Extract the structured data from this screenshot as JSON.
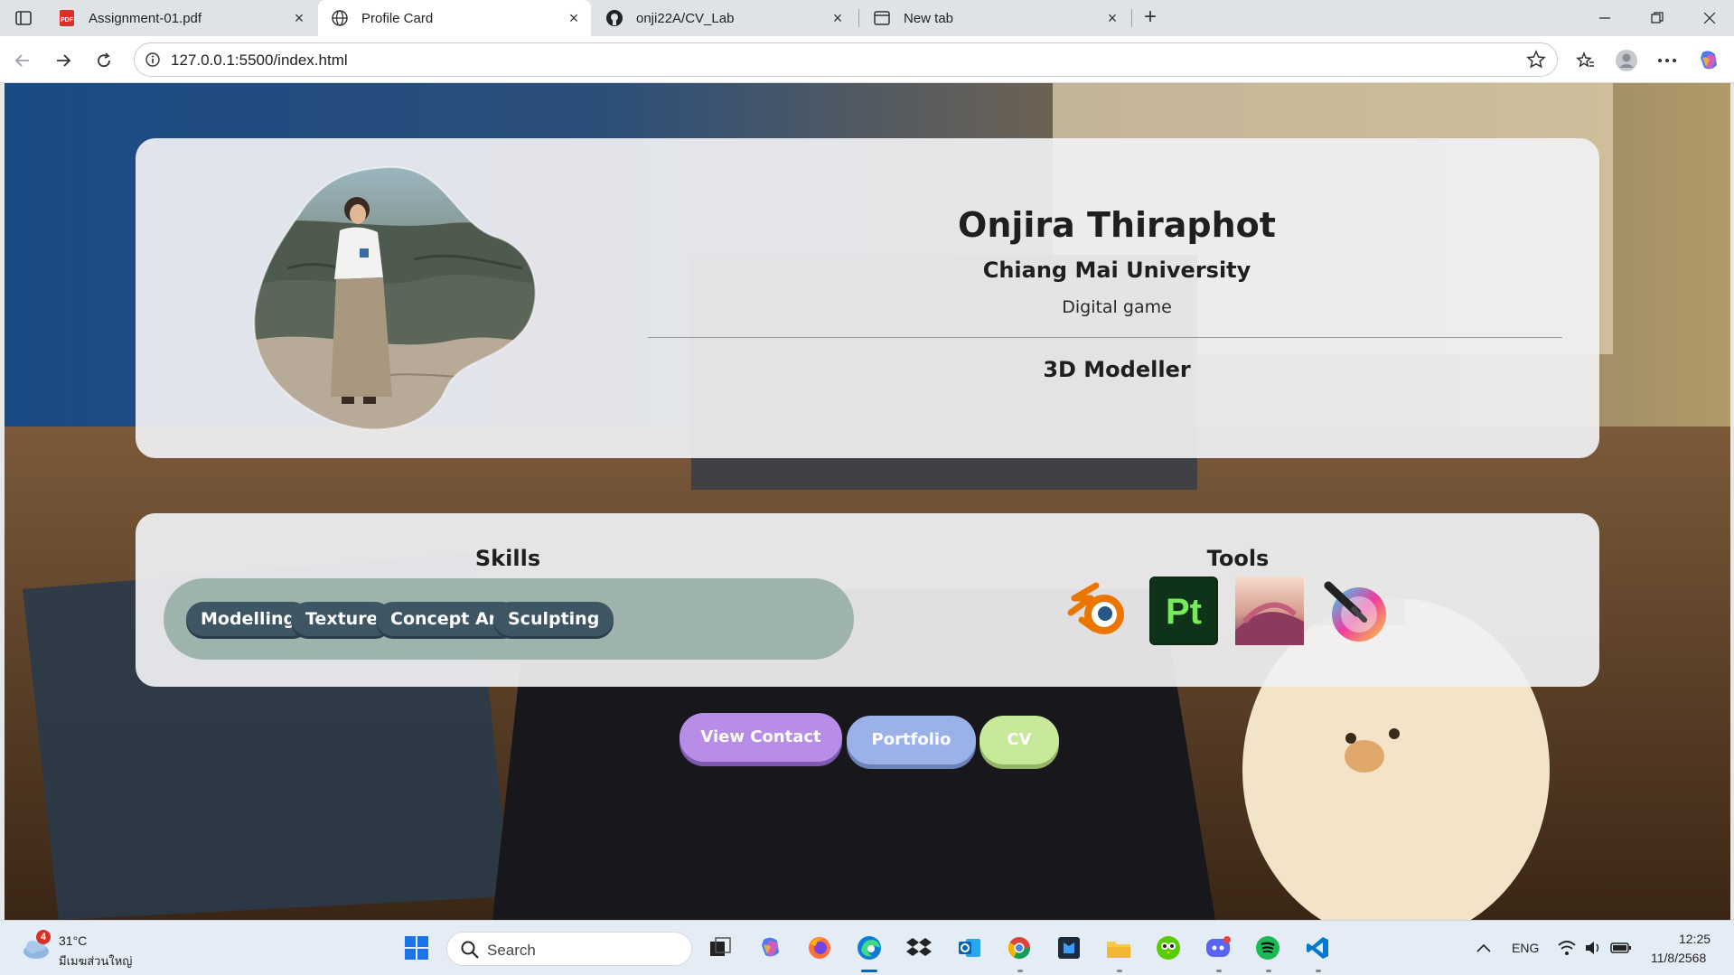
{
  "browser": {
    "tabs": [
      {
        "title": "Assignment-01.pdf",
        "icon": "pdf-icon"
      },
      {
        "title": "Profile Card",
        "icon": "globe-icon",
        "active": true
      },
      {
        "title": "onji22A/CV_Lab",
        "icon": "github-icon"
      },
      {
        "title": "New tab",
        "icon": "newtab-icon"
      }
    ],
    "url": "127.0.0.1:5500/index.html"
  },
  "profile": {
    "name": "Onjira Thiraphot",
    "university": "Chiang Mai University",
    "department": "Digital game",
    "role": "3D Modeller"
  },
  "skills": {
    "title": "Skills",
    "items": [
      "Modelling",
      "Texture",
      "Concept Art",
      "Sculpting"
    ]
  },
  "tools": {
    "title": "Tools",
    "items": [
      {
        "name": "blender-icon"
      },
      {
        "name": "substance-painter-icon",
        "label": "Pt"
      },
      {
        "name": "substance-designer-icon"
      },
      {
        "name": "krita-icon"
      }
    ]
  },
  "buttons": {
    "contact": "View Contact",
    "portfolio": "Portfolio",
    "cv": "CV"
  },
  "colors": {
    "contact": "#b78de8",
    "portfolio": "#9bb2e8",
    "cv": "#c8e89a",
    "chip": "#3e5563",
    "skills_box": "#9fb3ad"
  },
  "taskbar": {
    "weather_badge": "4",
    "temperature": "31°C",
    "location": "มีเมฆส่วนใหญ่",
    "search_placeholder": "Search",
    "language": "ENG",
    "time": "12:25",
    "date": "11/8/2568"
  }
}
